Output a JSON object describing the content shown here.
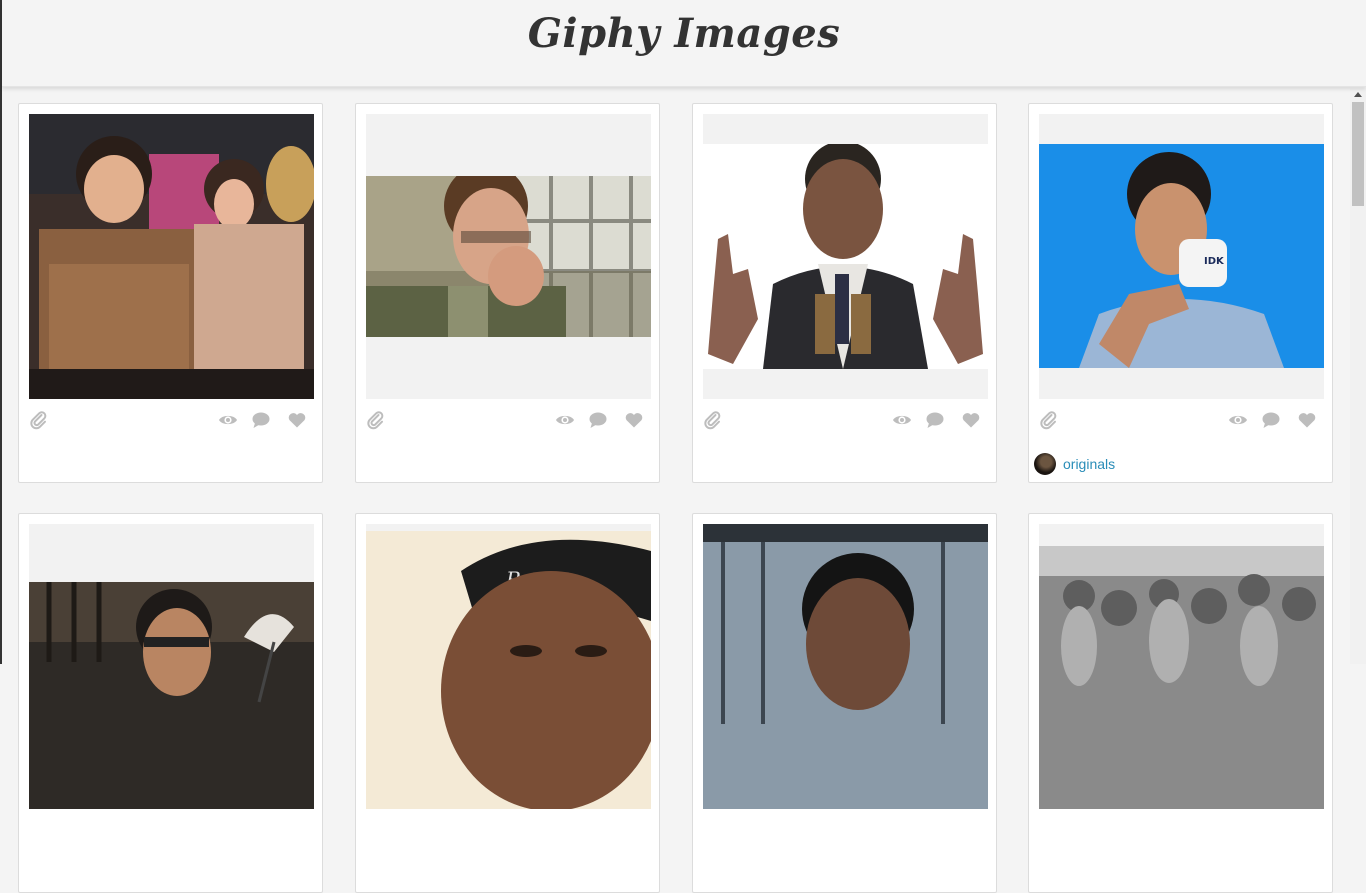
{
  "header": {
    "title": "Giphy Images"
  },
  "cards": [
    {
      "author": ""
    },
    {
      "author": ""
    },
    {
      "author": ""
    },
    {
      "author": "originals"
    },
    {
      "author": ""
    },
    {
      "author": ""
    },
    {
      "author": ""
    },
    {
      "author": ""
    }
  ],
  "icons": {
    "attach": "paperclip-icon",
    "views": "eye-icon",
    "comments": "comment-icon",
    "likes": "heart-icon"
  },
  "colors": {
    "background": "#f4f4f4",
    "card": "#ffffff",
    "icon": "#bdbdbd",
    "link": "#2a8db8",
    "title": "#333333"
  }
}
